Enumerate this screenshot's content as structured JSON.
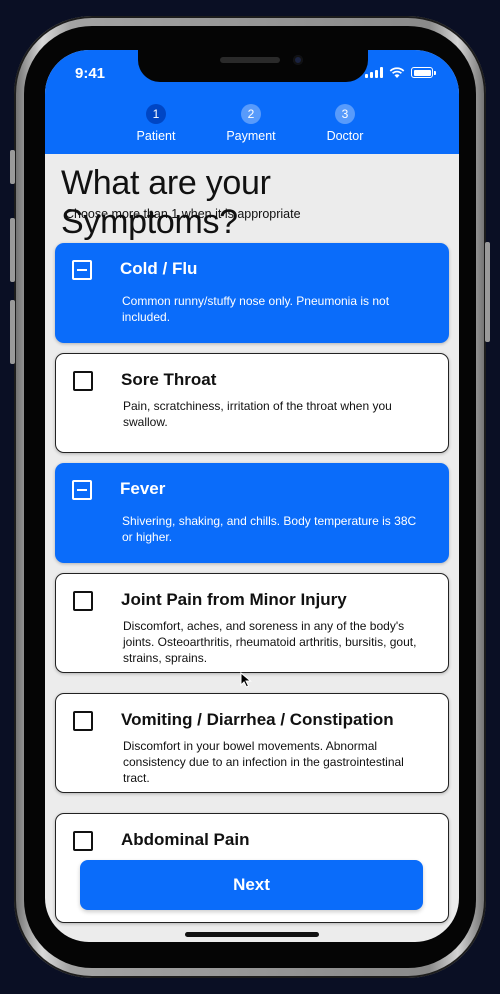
{
  "status_bar": {
    "time": "9:41"
  },
  "steps": [
    {
      "number": "1",
      "label": "Patient",
      "active": true
    },
    {
      "number": "2",
      "label": "Payment",
      "active": false
    },
    {
      "number": "3",
      "label": "Doctor",
      "active": false
    }
  ],
  "page": {
    "title": "What are your Symptoms?",
    "subtitle": "Choose more than 1 when it is appropriate"
  },
  "symptoms": [
    {
      "title": "Cold / Flu",
      "description": "Common runny/stuffy nose only. Pneumonia is not included.",
      "selected": true
    },
    {
      "title": "Sore Throat",
      "description": "Pain, scratchiness, irritation of the throat when you swallow.",
      "selected": false
    },
    {
      "title": "Fever",
      "description": "Shivering, shaking, and chills. Body temperature is 38C or higher.",
      "selected": true
    },
    {
      "title": "Joint Pain from Minor Injury",
      "description": "Discomfort, aches, and soreness in any of the body's joints. Osteoarthritis, rheumatoid arthritis, bursitis, gout, strains, sprains.",
      "selected": false
    },
    {
      "title": "Vomiting / Diarrhea / Constipation",
      "description": "Discomfort in your bowel movements. Abnormal consistency due to an infection in the gastrointestinal tract.",
      "selected": false
    },
    {
      "title": "Abdominal Pain",
      "description": "",
      "selected": false
    }
  ],
  "actions": {
    "next_label": "Next"
  },
  "colors": {
    "accent": "#0a6cfa",
    "active_step": "#0046c4",
    "background": "#ececec"
  },
  "icons": [
    "signal-icon",
    "wifi-icon",
    "battery-icon",
    "checkbox-icon",
    "minus-icon",
    "cursor-icon"
  ]
}
